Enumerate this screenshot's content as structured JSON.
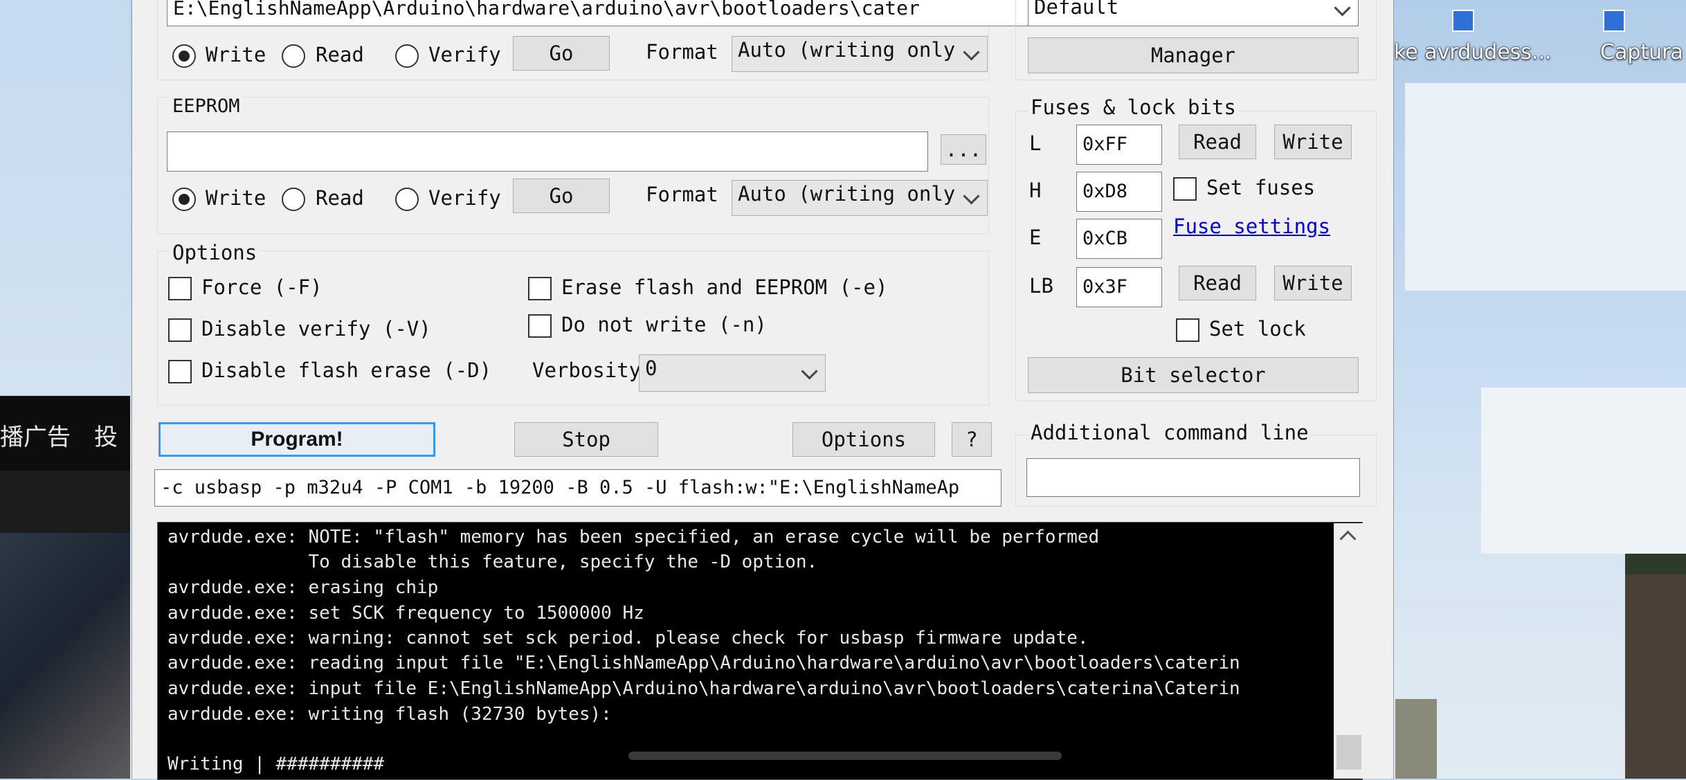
{
  "desktop": {
    "cn_text": "播广告　投",
    "icons": [
      {
        "label": "ke avrdudess..."
      },
      {
        "label": "Captura"
      }
    ]
  },
  "flash": {
    "path_value": "E:\\EnglishNameApp\\Arduino\\hardware\\arduino\\avr\\bootloaders\\cater",
    "browse_label": "...",
    "write_label": "Write",
    "read_label": "Read",
    "verify_label": "Verify",
    "go_label": "Go",
    "format_label": "Format",
    "format_value": "Auto (writing only"
  },
  "eeprom": {
    "title": "EEPROM",
    "path_value": "",
    "browse_label": "...",
    "write_label": "Write",
    "read_label": "Read",
    "verify_label": "Verify",
    "go_label": "Go",
    "format_label": "Format",
    "format_value": "Auto (writing only"
  },
  "options": {
    "title": "Options",
    "force": "Force (-F)",
    "disable_verify": "Disable verify (-V)",
    "disable_flash_erase": "Disable flash erase (-D)",
    "erase_flash_eeprom": "Erase flash and EEPROM (-e)",
    "do_not_write": "Do not write (-n)",
    "verbosity_label": "Verbosity",
    "verbosity_value": "0"
  },
  "right": {
    "preset_value": "Default",
    "manager_label": "Manager",
    "fuses_title": "Fuses & lock bits",
    "l_label": "L",
    "l_value": "0xFF",
    "h_label": "H",
    "h_value": "0xD8",
    "e_label": "E",
    "e_value": "0xCB",
    "lb_label": "LB",
    "lb_value": "0x3F",
    "read_label": "Read",
    "write_label": "Write",
    "set_fuses": "Set fuses",
    "fuse_settings": "Fuse settings",
    "set_lock": "Set lock",
    "bit_selector": "Bit selector",
    "additional_title": "Additional command line",
    "additional_value": ""
  },
  "actions": {
    "program": "Program!",
    "stop": "Stop",
    "options": "Options",
    "help": "?"
  },
  "command_line": "-c usbasp -p m32u4 -P COM1 -b 19200 -B 0.5 -U flash:w:\"E:\\EnglishNameAp",
  "console": [
    "avrdude.exe: NOTE: \"flash\" memory has been specified, an erase cycle will be performed",
    "             To disable this feature, specify the -D option.",
    "avrdude.exe: erasing chip",
    "avrdude.exe: set SCK frequency to 1500000 Hz",
    "avrdude.exe: warning: cannot set sck period. please check for usbasp firmware update.",
    "avrdude.exe: reading input file \"E:\\EnglishNameApp\\Arduino\\hardware\\arduino\\avr\\bootloaders\\caterin",
    "avrdude.exe: input file E:\\EnglishNameApp\\Arduino\\hardware\\arduino\\avr\\bootloaders\\caterina\\Caterin",
    "avrdude.exe: writing flash (32730 bytes):",
    "",
    "Writing | ##########"
  ]
}
